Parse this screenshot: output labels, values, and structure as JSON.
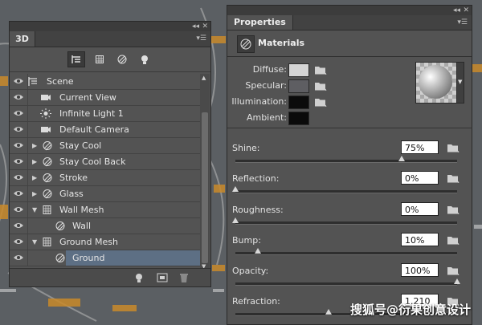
{
  "panel_3d": {
    "tab": "3D",
    "collapse_glyph": "◂◂",
    "close_glyph": "✕",
    "filters": [
      "scene-filter-icon",
      "mesh-filter-icon",
      "material-filter-icon",
      "light-filter-icon"
    ],
    "layers": [
      {
        "label": "Scene",
        "icon": "scene-icon",
        "arrow": ""
      },
      {
        "label": "Current View",
        "icon": "camera-icon",
        "arrow": ""
      },
      {
        "label": "Infinite Light 1",
        "icon": "light-icon",
        "arrow": ""
      },
      {
        "label": "Default Camera",
        "icon": "camera-icon",
        "arrow": ""
      },
      {
        "label": "Stay  Cool",
        "icon": "material-icon",
        "arrow": "▶"
      },
      {
        "label": "Stay  Cool Back",
        "icon": "material-icon",
        "arrow": "▶"
      },
      {
        "label": "Stroke",
        "icon": "material-icon",
        "arrow": "▶"
      },
      {
        "label": "Glass",
        "icon": "material-icon",
        "arrow": "▶"
      },
      {
        "label": "Wall Mesh",
        "icon": "mesh-icon",
        "arrow": "▼"
      },
      {
        "label": "Wall",
        "icon": "material-icon",
        "arrow": ""
      },
      {
        "label": "Ground Mesh",
        "icon": "mesh-icon",
        "arrow": "▼"
      },
      {
        "label": "Ground",
        "icon": "material-icon",
        "arrow": "",
        "selected": true
      }
    ],
    "bottom_icons": [
      "add-light-icon",
      "render-icon",
      "trash-icon"
    ]
  },
  "properties": {
    "tab": "Properties",
    "collapse_glyph": "◂◂",
    "close_glyph": "✕",
    "header": "Materials",
    "colors": [
      {
        "label": "Diffuse:",
        "color": "#d4d4d4"
      },
      {
        "label": "Specular:",
        "color": "#5e5e62"
      },
      {
        "label": "Illumination:",
        "color": "#0b0b0b"
      },
      {
        "label": "Ambient:",
        "color": "#0a0a0a"
      }
    ],
    "sliders": [
      {
        "label": "Shine:",
        "value": "75%",
        "level": 0.75
      },
      {
        "label": "Reflection:",
        "value": "0%",
        "level": 0.0
      },
      {
        "label": "Roughness:",
        "value": "0%",
        "level": 0.0
      },
      {
        "label": "Bump:",
        "value": "10%",
        "level": 0.1
      },
      {
        "label": "Opacity:",
        "value": "100%",
        "level": 1.0
      },
      {
        "label": "Refraction:",
        "value": "1.210",
        "level": 0.42
      }
    ]
  },
  "watermark": "搜狐号@衍果创意设计"
}
